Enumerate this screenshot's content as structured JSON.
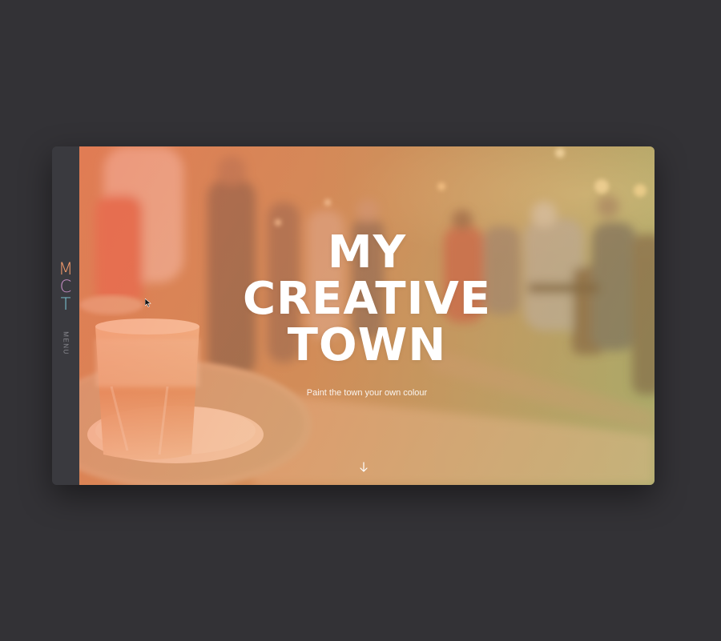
{
  "sidebar": {
    "logo": {
      "m": "M",
      "c": "C",
      "t": "T"
    },
    "menu_label": "MENU"
  },
  "hero": {
    "title_lines": [
      "MY",
      "CREATIVE",
      "TOWN"
    ],
    "subtitle": "Paint the town your own colour",
    "scroll_icon": "arrow-down-icon"
  },
  "colors": {
    "logo_m": "#f29a6b",
    "logo_c": "#c98fc8",
    "logo_t": "#7dc8d8",
    "page_background": "#333236",
    "sidebar_background": "#3a3a3f"
  }
}
